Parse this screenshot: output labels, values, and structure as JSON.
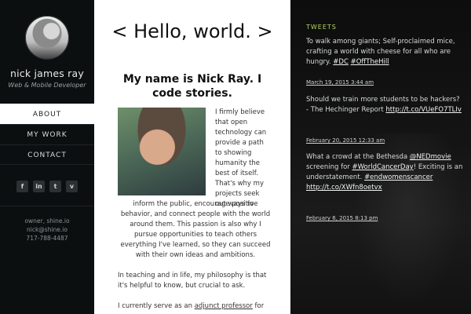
{
  "sidebar": {
    "name": "nick james ray",
    "tagline": "Web & Mobile Developer",
    "nav": [
      "ABOUT",
      "MY WORK",
      "CONTACT"
    ],
    "social": [
      {
        "icon": "facebook-icon",
        "label": "f"
      },
      {
        "icon": "linkedin-icon",
        "label": "in"
      },
      {
        "icon": "twitter-icon",
        "label": "t"
      },
      {
        "icon": "vimeo-icon",
        "label": "v"
      }
    ],
    "contact": [
      "owner, shine.io",
      "nick@shine.io",
      "717-788-4487"
    ]
  },
  "main": {
    "title": "< Hello, world. >",
    "subtitle": "My name is Nick Ray. I code stories.",
    "paragraphs": {
      "p1_wrap": "I firmly believe that open technology can provide a path to showing humanity the best of itself. That's why my projects seek out ways to",
      "p1_full": "inform the public, encourage positive behavior, and connect people with the world around them. This passion is also why I pursue opportunities to teach others everything I've learned, so they can succeed with their own ideas and ambitions.",
      "p2": "In teaching and in life, my philosophy is that it's helpful to know, but crucial to ask.",
      "p3_prefix": "I currently serve as an ",
      "p3_link": "adjunct professor",
      "p3_suffix": " for"
    }
  },
  "tweets": {
    "title": "TWEETS",
    "items": [
      {
        "text_a": "To walk among giants; Self-proclaimed mice, crafting a world with cheese for all who are hungry. ",
        "tag1": "#DC",
        "space": " ",
        "tag2": "#OffTheHill",
        "date": "March 19, 2015 3:44 am"
      },
      {
        "text_a": "Should we train more students to be hackers? - The Hechinger Report ",
        "link": "http://t.co/VUeFO7TLIv",
        "date": "February 20, 2015 12:33 am"
      },
      {
        "text_a": "What a crowd at the Bethesda ",
        "mention": "@NEDmovie",
        "text_b": " screening for ",
        "tag1": "#WorldCancerDay",
        "text_c": "! Exciting is an understatement. ",
        "tag2": "#endwomenscancer",
        "space": " ",
        "link": "http://t.co/XWfn8oetvx",
        "date": "February 6, 2015 8:13 pm"
      }
    ]
  },
  "colors": {
    "sidebar_bg": "#0c0f10",
    "accent_green": "#b7d36a",
    "main_bg": "#ffffff"
  }
}
